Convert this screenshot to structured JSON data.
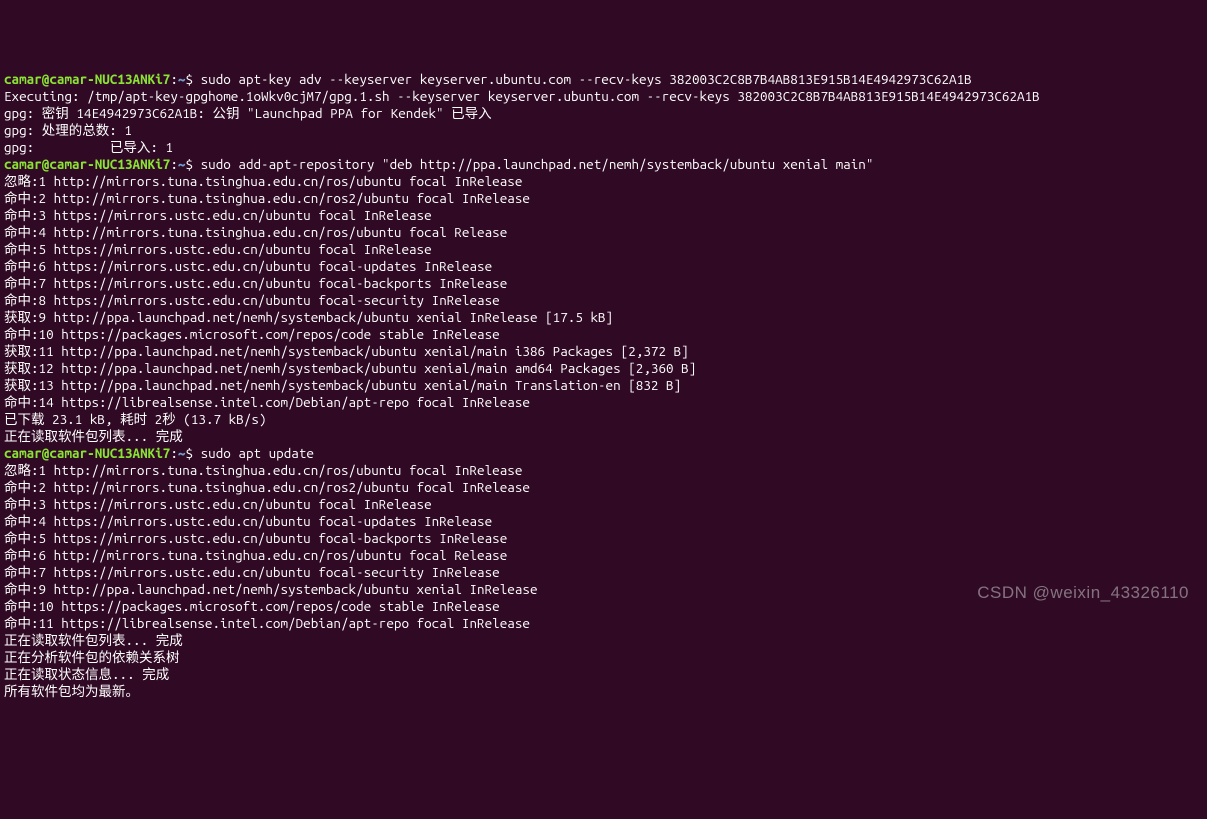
{
  "prompt": {
    "user_host": "camar@camar-NUC13ANKi7",
    "colon": ":",
    "path": "~",
    "symbol": "$"
  },
  "cmd1": "sudo apt-key adv --keyserver keyserver.ubuntu.com --recv-keys 382003C2C8B7B4AB813E915B14E4942973C62A1B",
  "out1_l1": "Executing: /tmp/apt-key-gpghome.1oWkv0cjM7/gpg.1.sh --keyserver keyserver.ubuntu.com --recv-keys 382003C2C8B7B4AB813E915B14E4942973C62A1B",
  "out1_l2": "gpg: 密钥 14E4942973C62A1B: 公钥 \"Launchpad PPA for Kendek\" 已导入",
  "out1_l3": "gpg: 处理的总数: 1",
  "out1_l4": "gpg:          已导入: 1",
  "cmd2": "sudo add-apt-repository \"deb http://ppa.launchpad.net/nemh/systemback/ubuntu xenial main\"",
  "out2_l1": "忽略:1 http://mirrors.tuna.tsinghua.edu.cn/ros/ubuntu focal InRelease",
  "out2_l2": "命中:2 http://mirrors.tuna.tsinghua.edu.cn/ros2/ubuntu focal InRelease",
  "out2_l3": "命中:3 https://mirrors.ustc.edu.cn/ubuntu focal InRelease",
  "out2_l4": "命中:4 http://mirrors.tuna.tsinghua.edu.cn/ros/ubuntu focal Release",
  "out2_l5": "命中:5 https://mirrors.ustc.edu.cn/ubuntu focal InRelease",
  "out2_l6": "命中:6 https://mirrors.ustc.edu.cn/ubuntu focal-updates InRelease",
  "out2_l7": "命中:7 https://mirrors.ustc.edu.cn/ubuntu focal-backports InRelease",
  "out2_l8": "命中:8 https://mirrors.ustc.edu.cn/ubuntu focal-security InRelease",
  "out2_l9": "获取:9 http://ppa.launchpad.net/nemh/systemback/ubuntu xenial InRelease [17.5 kB]",
  "out2_l10": "命中:10 https://packages.microsoft.com/repos/code stable InRelease",
  "out2_l11": "获取:11 http://ppa.launchpad.net/nemh/systemback/ubuntu xenial/main i386 Packages [2,372 B]",
  "out2_l12": "获取:12 http://ppa.launchpad.net/nemh/systemback/ubuntu xenial/main amd64 Packages [2,360 B]",
  "out2_l13": "获取:13 http://ppa.launchpad.net/nemh/systemback/ubuntu xenial/main Translation-en [832 B]",
  "out2_l14": "命中:14 https://librealsense.intel.com/Debian/apt-repo focal InRelease",
  "out2_l15": "已下载 23.1 kB, 耗时 2秒 (13.7 kB/s)",
  "out2_l16": "正在读取软件包列表... 完成",
  "cmd3": "sudo apt update",
  "out3_l1": "忽略:1 http://mirrors.tuna.tsinghua.edu.cn/ros/ubuntu focal InRelease",
  "out3_l2": "命中:2 http://mirrors.tuna.tsinghua.edu.cn/ros2/ubuntu focal InRelease",
  "out3_l3": "命中:3 https://mirrors.ustc.edu.cn/ubuntu focal InRelease",
  "out3_l4": "命中:4 https://mirrors.ustc.edu.cn/ubuntu focal-updates InRelease",
  "out3_l5": "命中:5 https://mirrors.ustc.edu.cn/ubuntu focal-backports InRelease",
  "out3_l6": "命中:6 http://mirrors.tuna.tsinghua.edu.cn/ros/ubuntu focal Release",
  "out3_l7": "命中:7 https://mirrors.ustc.edu.cn/ubuntu focal-security InRelease",
  "out3_l8": "命中:9 http://ppa.launchpad.net/nemh/systemback/ubuntu xenial InRelease",
  "out3_l9": "命中:10 https://packages.microsoft.com/repos/code stable InRelease",
  "out3_l10": "命中:11 https://librealsense.intel.com/Debian/apt-repo focal InRelease",
  "out3_l11": "正在读取软件包列表... 完成",
  "out3_l12": "正在分析软件包的依赖关系树",
  "out3_l13": "正在读取状态信息... 完成",
  "out3_l14": "所有软件包均为最新。",
  "watermark": "CSDN @weixin_43326110"
}
